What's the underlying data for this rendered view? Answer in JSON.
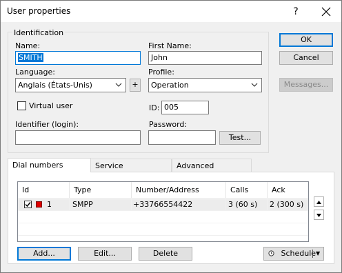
{
  "window": {
    "title": "User properties",
    "help_glyph": "?",
    "close_glyph": "✕"
  },
  "identification": {
    "caption": "Identification",
    "name_label": "Name:",
    "name_value": "SMITH",
    "first_name_label": "First Name:",
    "first_name_value": "John",
    "language_label": "Language:",
    "language_value": "Anglais (États-Unis)",
    "language_add": "+",
    "profile_label": "Profile:",
    "profile_value": "Operation",
    "virtual_user_label": "Virtual user",
    "virtual_user_checked": false,
    "id_label": "ID:",
    "id_value": "005",
    "identifier_label": "Identifier (login):",
    "identifier_value": "",
    "password_label": "Password:",
    "password_value": "",
    "test_button": "Test..."
  },
  "side_buttons": {
    "ok": "OK",
    "cancel": "Cancel",
    "messages": "Messages..."
  },
  "tabs": [
    {
      "label": "Dial numbers",
      "active": true
    },
    {
      "label": "Service",
      "active": false
    },
    {
      "label": "Advanced",
      "active": false
    }
  ],
  "dial_numbers": {
    "columns": [
      "Id",
      "Type",
      "Number/Address",
      "Calls",
      "Ack"
    ],
    "rows": [
      {
        "checked": true,
        "color": "#e00000",
        "id": "1",
        "type": "SMPP",
        "number": "+33766554422",
        "calls": "3 (60 s)",
        "ack": "2 (300 s)"
      }
    ],
    "up_glyph": "▲",
    "down_glyph": "▼",
    "add_button": "Add...",
    "edit_button": "Edit...",
    "delete_button": "Delete",
    "schedule_button": "Schedule",
    "schedule_arrow": "▼"
  },
  "colors": {
    "accent": "#0078d7",
    "face": "#f0f0f0"
  }
}
